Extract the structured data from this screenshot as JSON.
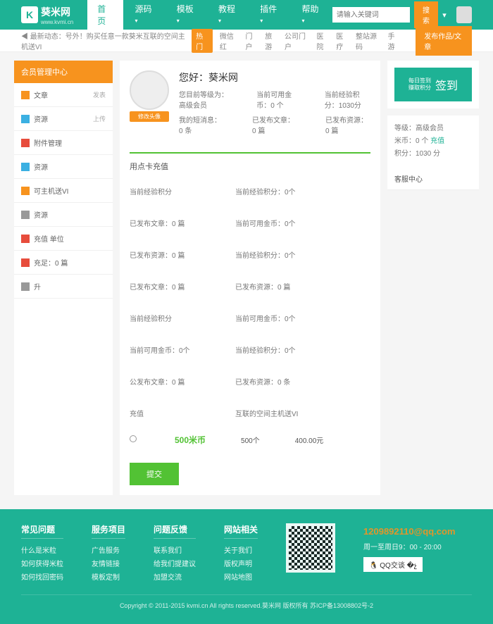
{
  "header": {
    "logo_text": "葵米网",
    "logo_sub": "www.kvmi.cn",
    "nav": [
      "首页",
      "源码",
      "模板",
      "教程",
      "插件",
      "帮助"
    ],
    "search_placeholder": "请输入关键词",
    "search_btn": "搜索"
  },
  "subheader": {
    "announce": "◀ 最新动态：号外！购买任意一款葵米互联的空间主机送VI",
    "tags": [
      "热门",
      "微信红",
      "门户",
      "旅游",
      "公司门户",
      "医院",
      "医疗",
      "整站源码",
      "手游"
    ],
    "publish": "发布作品/文章"
  },
  "sidebar": {
    "title": "会员管理中心",
    "items": [
      {
        "label": "文章",
        "right": "发表",
        "color": "#f7931e"
      },
      {
        "label": "资源",
        "right": "上传",
        "color": "#3bb0e2"
      },
      {
        "label": "附件管理",
        "right": "",
        "color": "#e74c3c"
      },
      {
        "label": "资源",
        "right": "",
        "color": "#3bb0e2"
      },
      {
        "label": "可主机送VI",
        "right": "",
        "color": "#f7931e"
      },
      {
        "label": "资源",
        "right": "",
        "color": "#999"
      },
      {
        "label": "充值  单位",
        "right": "",
        "color": "#e74c3c"
      },
      {
        "label": "充足：0 篇",
        "right": "",
        "color": "#e74c3c"
      },
      {
        "label": "升",
        "right": "",
        "color": "#999"
      }
    ]
  },
  "profile": {
    "greet": "您好：葵米网",
    "av_label": "修改头像",
    "level_label": "您目前等级为：",
    "level_val": "高级会员",
    "coin_label": "当前可用金币：",
    "coin_val": "0 个",
    "exp_label": "当前经验积分：",
    "exp_val": "1030分",
    "msg_label": "我的短消息：",
    "msg_val": "0 条",
    "art_label": "已发布文章：",
    "art_val": "0 篇",
    "res_label": "已发布资源：",
    "res_val": "0 篇"
  },
  "section1": "用点卡充值",
  "stats": [
    {
      "k": "当前经验积分",
      "v": ""
    },
    {
      "k": "当前经验积分：",
      "v": "0个"
    },
    {
      "k": "已发布文章：",
      "v": "0 篇"
    },
    {
      "k": "当前可用金币：",
      "v": "0个"
    },
    {
      "k": "已发布资源：",
      "v": "0 篇"
    },
    {
      "k": "当前经验积分：",
      "v": "0个"
    },
    {
      "k": "已发布文章：",
      "v": "0 篇"
    },
    {
      "k": "已发布资源：",
      "v": "0 篇"
    },
    {
      "k": "当前经验积分",
      "v": ""
    },
    {
      "k": "当前可用金币：",
      "v": "0个"
    },
    {
      "k": "当前可用金币：",
      "v": "0个"
    },
    {
      "k": "当前经验积分：",
      "v": "0个"
    },
    {
      "k": "公发布文章：",
      "v": "0 篇"
    },
    {
      "k": "已发布资源：",
      "v": "0 条"
    },
    {
      "k": "充值",
      "v": ""
    },
    {
      "k": "互联的空间主机送VI",
      "v": ""
    }
  ],
  "prices": {
    "p1": "500米币",
    "p2": "500个",
    "p3": "400.00元"
  },
  "submit": "提交",
  "right": {
    "signin_pre1": "每日签到",
    "signin_pre2": "赚取积分",
    "signin": "签到",
    "level": "等级：高级会员",
    "coin": "米币：0 个 ",
    "coin_link": "充值",
    "score": "积分：1030 分",
    "side_title": "客服中心"
  },
  "footer": {
    "cols": [
      {
        "h": "常见问题",
        "items": [
          "什么是米粒",
          "如何获得米粒",
          "如何找回密码"
        ]
      },
      {
        "h": "服务项目",
        "items": [
          "广告服务",
          "友情链接",
          "模板定制"
        ]
      },
      {
        "h": "问题反馈",
        "items": [
          "联系我们",
          "给我们提建议",
          "加盟交流"
        ]
      },
      {
        "h": "网站相关",
        "items": [
          "关于我们",
          "版权声明",
          "网站地图"
        ]
      }
    ],
    "email": "1209892110@qq.com",
    "hours": "周一至周日9：00 - 20:00",
    "qq": "QQ交谈",
    "copyright": "Copyright © 2011-2015 kvmi.cn All rights reserved.葵米网 版权所有  苏ICP备13008802号-2"
  }
}
